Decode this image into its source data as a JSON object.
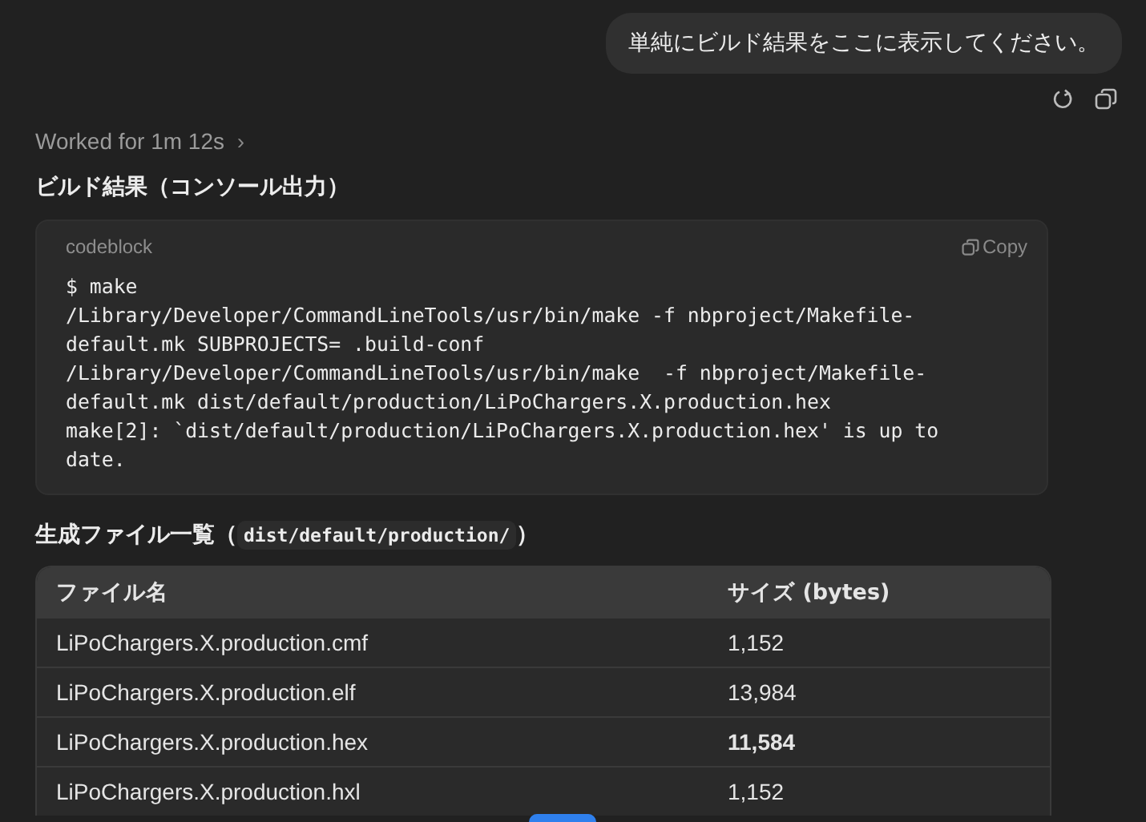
{
  "user_message": {
    "text": "単純にビルド結果をここに表示してください。"
  },
  "worked_for": {
    "text": "Worked for 1m 12s",
    "chevron": "›"
  },
  "build_heading": {
    "text": "ビルド結果（コンソール出力）"
  },
  "codeblock": {
    "language": "codeblock",
    "copy_label": "Copy",
    "lines": [
      "$ make",
      "/Library/Developer/CommandLineTools/usr/bin/make -f nbproject/Makefile-",
      "default.mk SUBPROJECTS= .build-conf",
      "/Library/Developer/CommandLineTools/usr/bin/make  -f nbproject/Makefile-",
      "default.mk dist/default/production/LiPoChargers.X.production.hex",
      "make[2]: `dist/default/production/LiPoChargers.X.production.hex' is up to",
      "date."
    ]
  },
  "files_heading": {
    "before": "生成ファイル一覧（",
    "code": "dist/default/production/",
    "after": "）"
  },
  "table": {
    "columns": [
      "ファイル名",
      "サイズ (bytes)"
    ],
    "rows": [
      {
        "cells": [
          "LiPoChargers.X.production.cmf",
          "1,152"
        ],
        "bold": false
      },
      {
        "cells": [
          "LiPoChargers.X.production.elf",
          "13,984"
        ],
        "bold": false
      },
      {
        "cells": [
          "LiPoChargers.X.production.hex",
          "11,584"
        ],
        "bold": true
      },
      {
        "cells": [
          "LiPoChargers.X.production.hxl",
          "1,152"
        ],
        "bold": false
      }
    ]
  }
}
